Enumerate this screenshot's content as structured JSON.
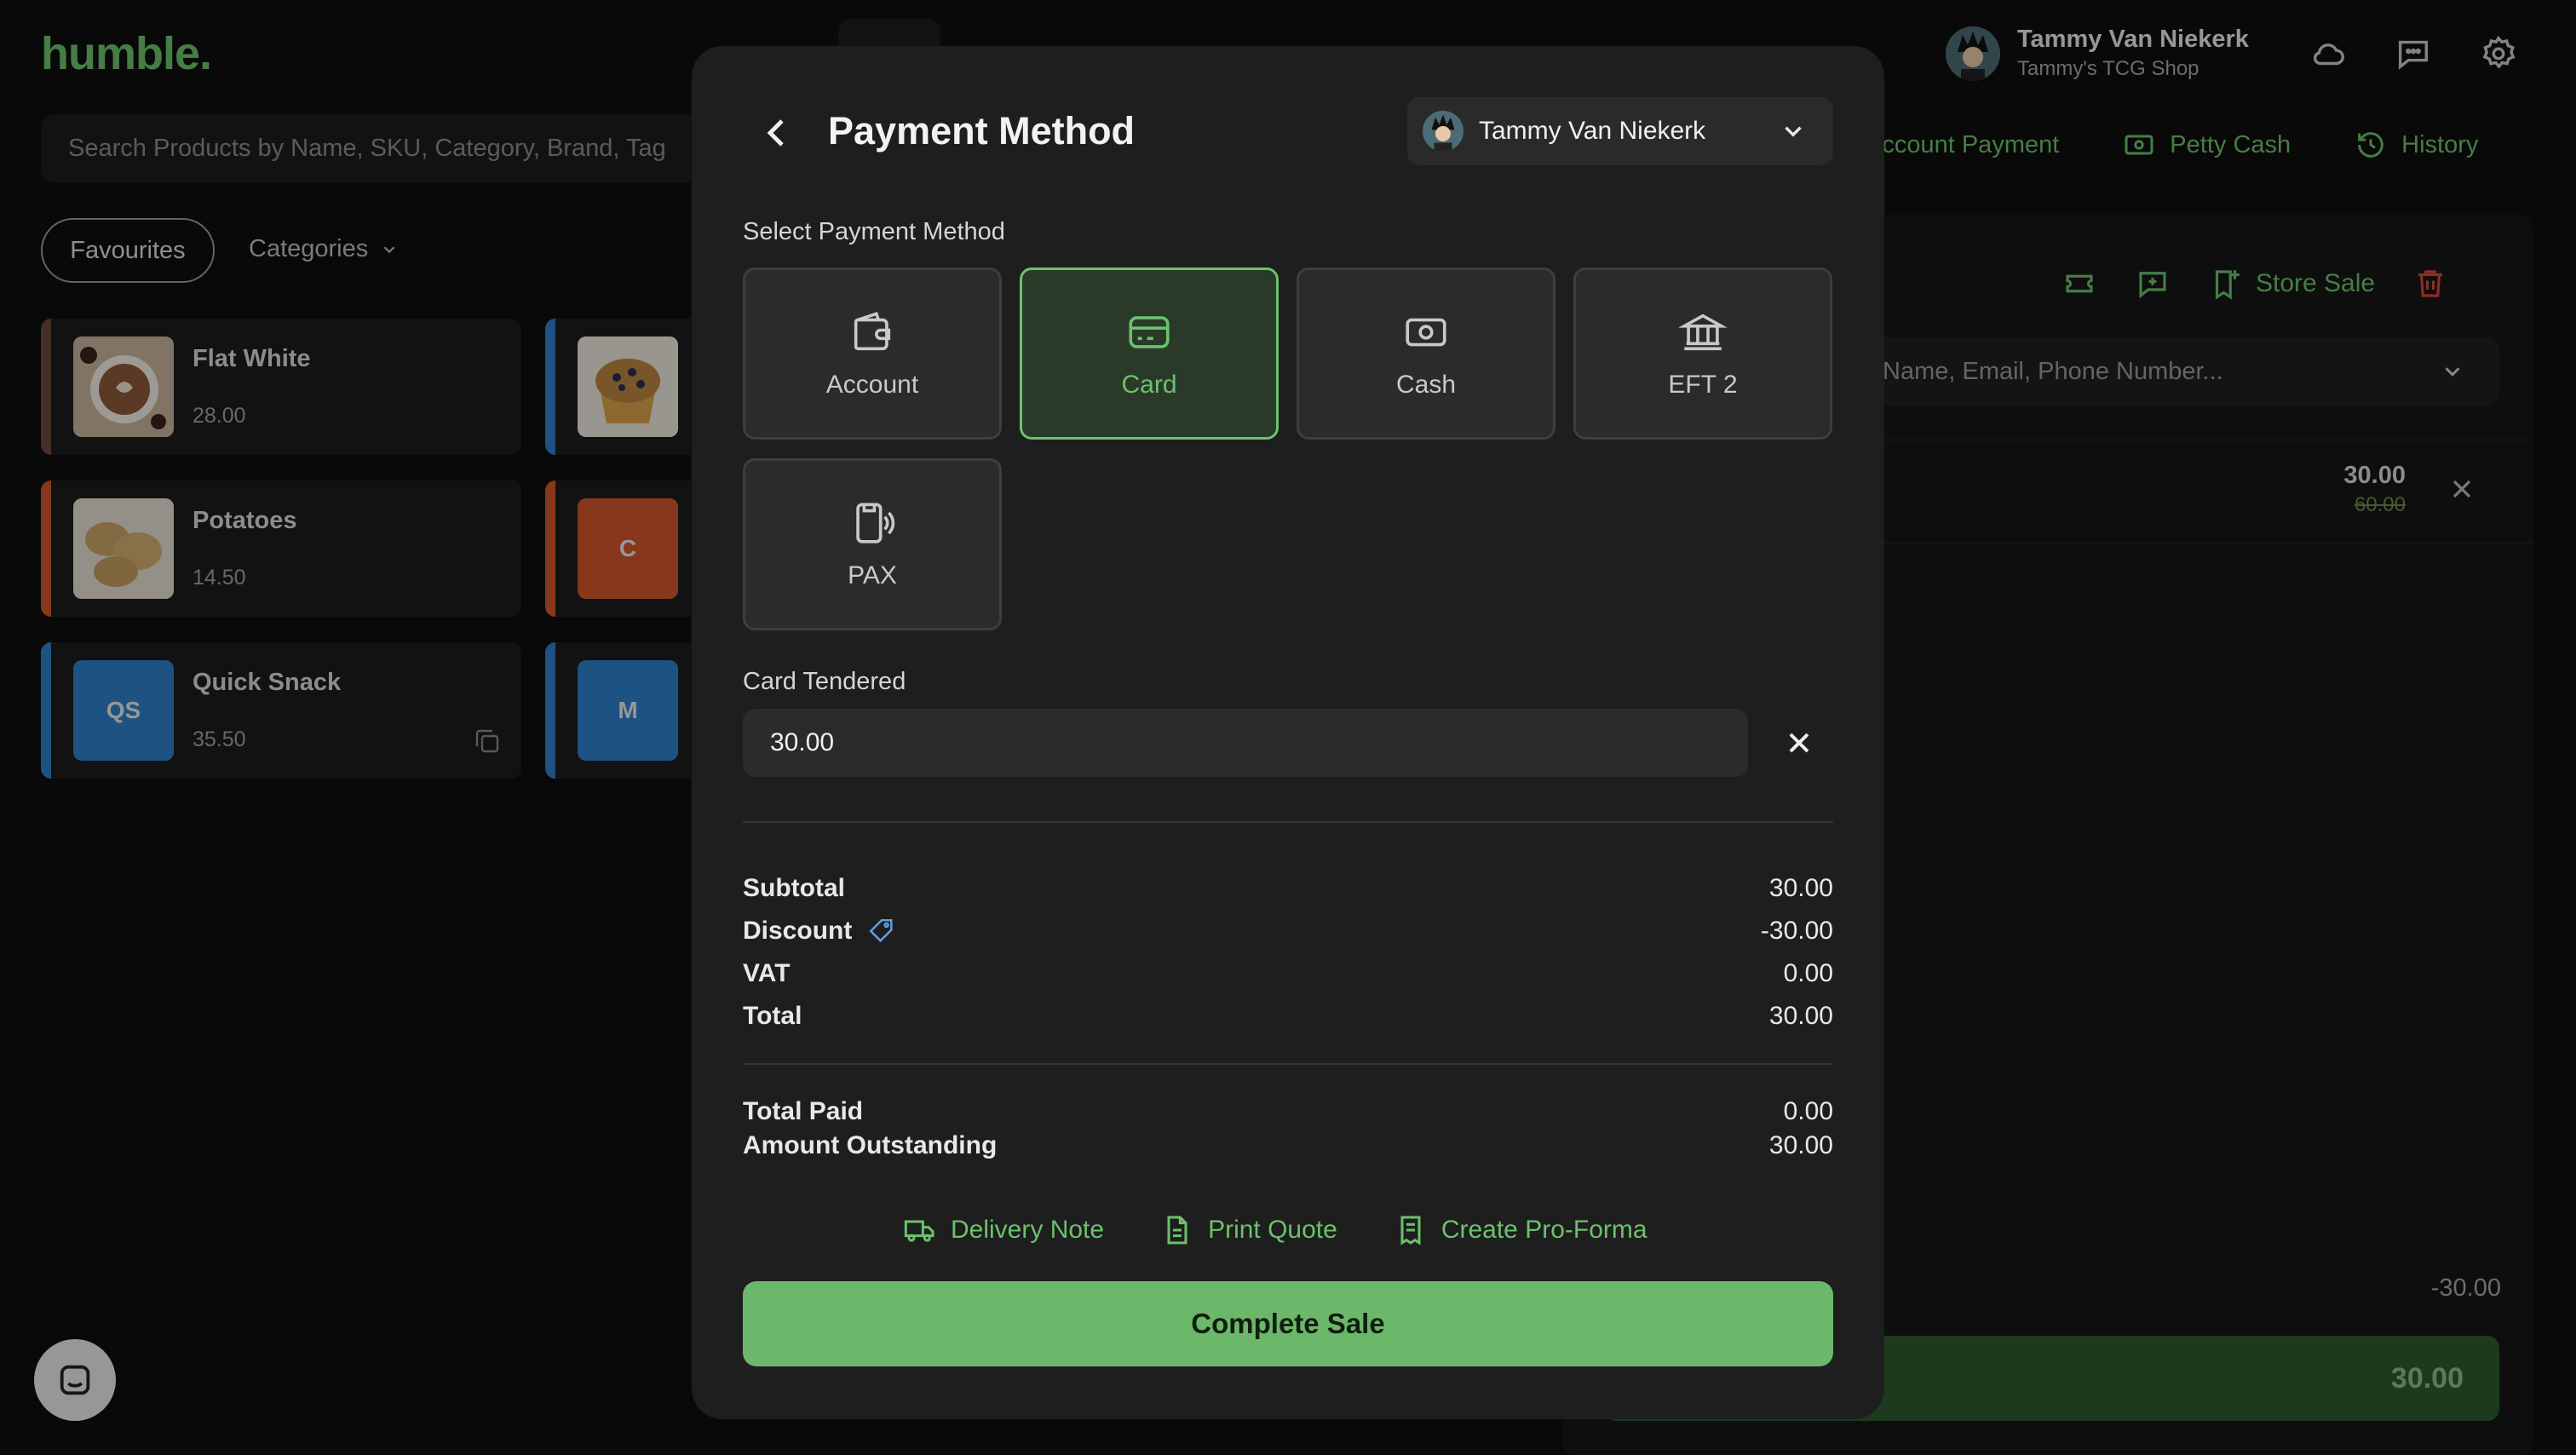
{
  "app": {
    "logo": "humble.",
    "user_name": "Tammy Van Niekerk",
    "shop_name": "Tammy's TCG Shop",
    "search_placeholder": "Search Products by Name, SKU, Category, Brand, Tag",
    "actions": [
      "Account Payment",
      "Petty Cash",
      "History"
    ],
    "filters": {
      "favourites": "Favourites",
      "categories": "Categories"
    },
    "products": [
      {
        "name": "Flat White",
        "price": "28.00",
        "color": "#6b4a3a",
        "thumb": ""
      },
      {
        "name": "Potatoes",
        "price": "14.50",
        "color": "#d0562b",
        "thumb": ""
      },
      {
        "name": "Quick Snack",
        "price": "35.50",
        "color": "#2d7fc8",
        "thumb": "QS"
      }
    ],
    "products_col2": [
      {
        "color": "#2d7fc8",
        "thumb": ""
      },
      {
        "color": "#d0562b",
        "thumb": "C"
      },
      {
        "color": "#2d7fc8",
        "thumb": "M"
      }
    ],
    "cart": {
      "store_sale": "Store Sale",
      "customer_placeholder": "Name, Email, Phone Number...",
      "line_price": "30.00",
      "line_original": "60.00",
      "discount": "-30.00",
      "pay_total": "30.00"
    }
  },
  "modal": {
    "title": "Payment Method",
    "selected_user": "Tammy Van Niekerk",
    "select_label": "Select Payment Method",
    "methods": [
      {
        "label": "Account",
        "icon": "wallet-icon",
        "selected": false
      },
      {
        "label": "Card",
        "icon": "credit-card-icon",
        "selected": true
      },
      {
        "label": "Cash",
        "icon": "cash-icon",
        "selected": false
      },
      {
        "label": "EFT 2",
        "icon": "bank-icon",
        "selected": false
      },
      {
        "label": "PAX",
        "icon": "pax-terminal-icon",
        "selected": false
      }
    ],
    "tender_label": "Card Tendered",
    "tender_value": "30.00",
    "summary": {
      "subtotal_label": "Subtotal",
      "subtotal": "30.00",
      "discount_label": "Discount",
      "discount": "-30.00",
      "vat_label": "VAT",
      "vat": "0.00",
      "total_label": "Total",
      "total": "30.00",
      "total_paid_label": "Total Paid",
      "total_paid": "0.00",
      "outstanding_label": "Amount Outstanding",
      "outstanding": "30.00"
    },
    "doc_actions": [
      "Delivery Note",
      "Print Quote",
      "Create Pro-Forma"
    ],
    "complete_label": "Complete Sale"
  },
  "colors": {
    "accent": "#6cc16c",
    "danger": "#d9463d",
    "info": "#5a9fe0"
  }
}
